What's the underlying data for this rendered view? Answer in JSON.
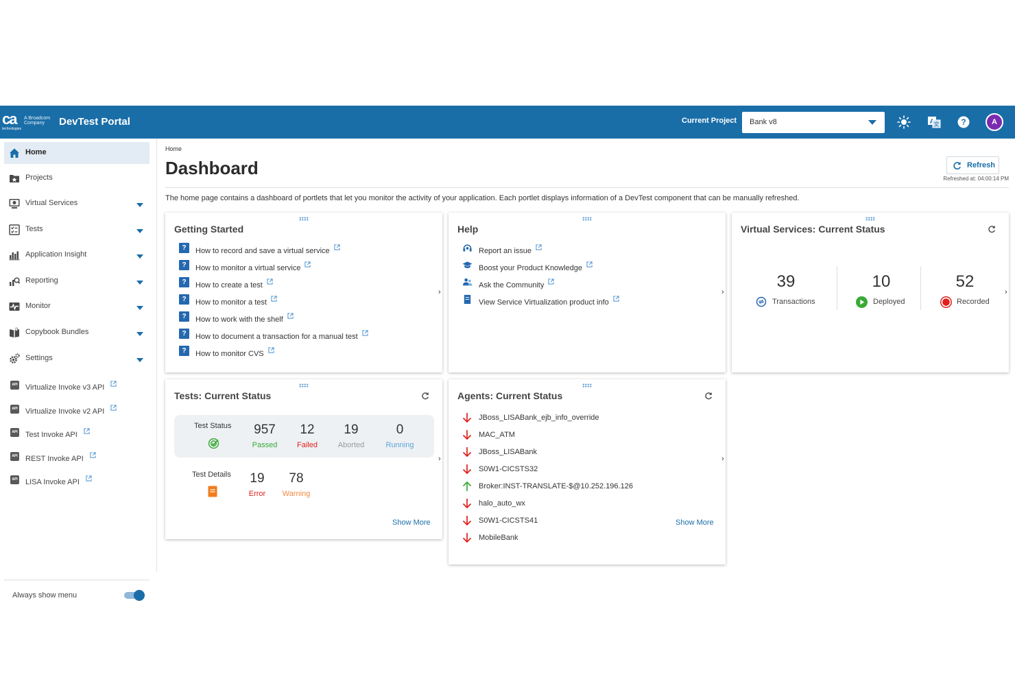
{
  "header": {
    "brand_main": "ca",
    "brand_sub": "technologies",
    "brand_company_line1": "A Broadcom",
    "brand_company_line2": "Company",
    "app_title": "DevTest Portal",
    "current_project_label": "Current Project",
    "current_project_value": "Bank v8",
    "avatar_initial": "A"
  },
  "sidebar": {
    "items": [
      {
        "label": "Home",
        "icon": "home-icon",
        "active": true
      },
      {
        "label": "Projects",
        "icon": "projects-icon"
      },
      {
        "label": "Virtual Services",
        "icon": "virtual-services-icon"
      },
      {
        "label": "Tests",
        "icon": "tests-icon"
      },
      {
        "label": "Application Insight",
        "icon": "bar-chart-icon"
      },
      {
        "label": "Reporting",
        "icon": "reporting-icon"
      },
      {
        "label": "Monitor",
        "icon": "monitor-icon"
      },
      {
        "label": "Copybook Bundles",
        "icon": "book-icon"
      },
      {
        "label": "Settings",
        "icon": "gear-icon"
      }
    ],
    "api_items": [
      {
        "label": "Virtualize Invoke v3 API",
        "badge": "API"
      },
      {
        "label": "Virtualize Invoke v2 API",
        "badge": "API"
      },
      {
        "label": "Test Invoke API",
        "badge": "API"
      },
      {
        "label": "REST Invoke API",
        "badge": "API"
      },
      {
        "label": "LISA Invoke API",
        "badge": "API"
      }
    ],
    "always_show_menu_label": "Always show menu",
    "always_show_menu_on": true
  },
  "main": {
    "breadcrumb": "Home",
    "title": "Dashboard",
    "refresh_label": "Refresh",
    "refreshed_at": "Refreshed at: 04:00:14 PM",
    "intro": "The home page contains a dashboard of portlets that let you monitor the activity of your application. Each portlet displays information of a DevTest component that can be manually refreshed."
  },
  "getting_started": {
    "title": "Getting Started",
    "links": [
      "How to record and save a virtual service",
      "How to monitor a virtual service",
      "How to create a test",
      "How to monitor a test",
      "How to work with the shelf",
      "How to document a transaction for a manual test",
      "How to monitor CVS"
    ]
  },
  "help": {
    "title": "Help",
    "links": [
      {
        "label": "Report an issue",
        "icon": "headset-icon"
      },
      {
        "label": "Boost your Product Knowledge",
        "icon": "graduation-cap-icon"
      },
      {
        "label": "Ask the Community",
        "icon": "community-icon"
      },
      {
        "label": "View Service Virtualization product info",
        "icon": "document-icon"
      }
    ]
  },
  "vs_status": {
    "title": "Virtual Services: Current Status",
    "stats": [
      {
        "value": "39",
        "label": "Transactions",
        "icon": "transactions-icon"
      },
      {
        "value": "10",
        "label": "Deployed",
        "icon": "play-icon",
        "color": "#3aaa35"
      },
      {
        "value": "52",
        "label": "Recorded",
        "icon": "record-icon",
        "color": "#e0201b"
      }
    ]
  },
  "tests_status": {
    "title": "Tests: Current Status",
    "status_label": "Test Status",
    "status_stats": [
      {
        "value": "957",
        "label": "Passed",
        "color": "#3aaa35"
      },
      {
        "value": "12",
        "label": "Failed",
        "color": "#e0201b"
      },
      {
        "value": "19",
        "label": "Aborted",
        "color": "#999999"
      },
      {
        "value": "0",
        "label": "Running",
        "color": "#5ba4d8"
      }
    ],
    "details_label": "Test Details",
    "detail_stats": [
      {
        "value": "19",
        "label": "Error",
        "color": "#e0201b"
      },
      {
        "value": "78",
        "label": "Warning",
        "color": "#f08a3c"
      }
    ],
    "show_more": "Show More"
  },
  "agents_status": {
    "title": "Agents: Current Status",
    "agents": [
      {
        "name": "JBoss_LISABank_ejb_info_override",
        "state": "down"
      },
      {
        "name": "MAC_ATM",
        "state": "down"
      },
      {
        "name": "JBoss_LISABank",
        "state": "down"
      },
      {
        "name": "S0W1-CICSTS32",
        "state": "down"
      },
      {
        "name": "Broker:INST-TRANSLATE-$@10.252.196.126",
        "state": "up"
      },
      {
        "name": "halo_auto_wx",
        "state": "down"
      },
      {
        "name": "S0W1-CICSTS41",
        "state": "down"
      },
      {
        "name": "MobileBank",
        "state": "down"
      }
    ],
    "show_more": "Show More"
  },
  "colors": {
    "brand_blue": "#1a6ea8",
    "up_green": "#3aaa35",
    "down_red": "#e0201b"
  }
}
